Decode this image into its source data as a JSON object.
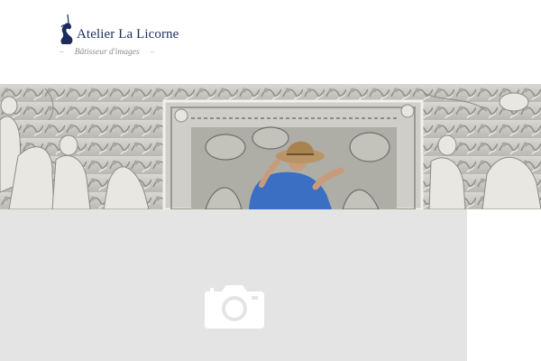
{
  "brand": {
    "name": "Atelier La Licorne",
    "tagline_dash_left": "–",
    "tagline": "Bâtisseur d'images",
    "tagline_dash_right": "–",
    "logo_icon": "unicorn-icon",
    "color": "#1b2b5b"
  },
  "hero": {
    "image_icon": "stone-relief-carving-photo"
  },
  "placeholder": {
    "icon": "camera-icon",
    "background": "#e4e4e4"
  }
}
